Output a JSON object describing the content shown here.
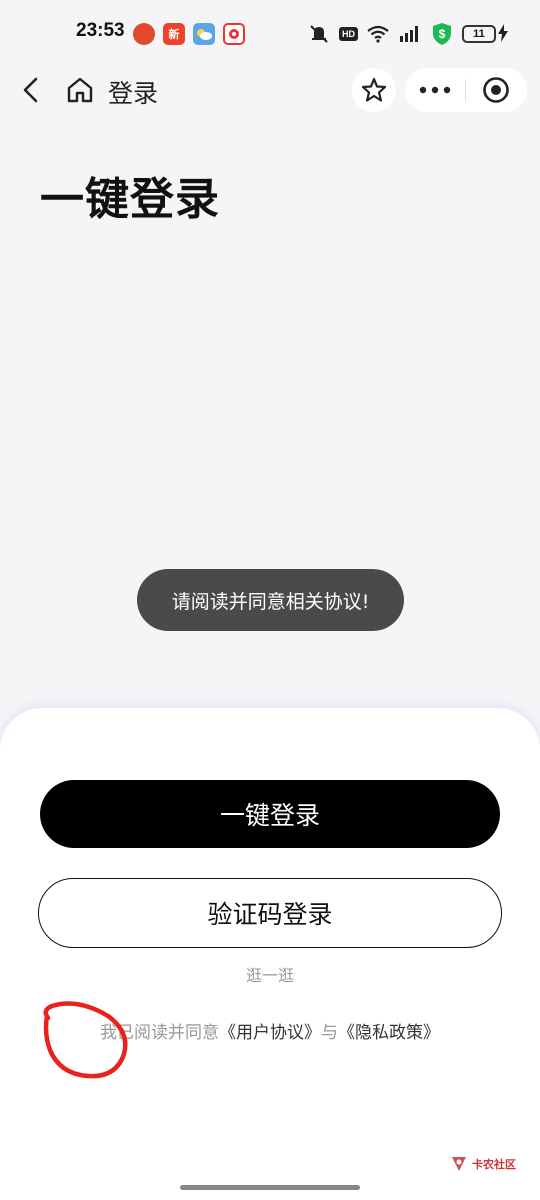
{
  "status_bar": {
    "time": "23:53",
    "hd": "HD",
    "battery": "11",
    "notif_icons": [
      "red-app-icon",
      "xin-app-icon",
      "weather-icon",
      "game-app-icon"
    ],
    "notif_xin_label": "新"
  },
  "nav": {
    "title": "登录"
  },
  "page": {
    "title": "一键登录"
  },
  "toast": {
    "text": "请阅读并同意相关协议!"
  },
  "sheet": {
    "primary_button": "一键登录",
    "secondary_button": "验证码登录",
    "browse_link": "逛一逛",
    "agreement_prefix": "我已阅读并同意",
    "user_agreement": "《用户协议》",
    "agreement_and": "与",
    "privacy_policy": "《隐私政策》"
  },
  "watermark": {
    "text": "卡农社区"
  },
  "colors": {
    "background": "#f5f5f7",
    "primary_button": "#000000",
    "toast": "#4a4a4a",
    "annotation": "#e8231d"
  }
}
